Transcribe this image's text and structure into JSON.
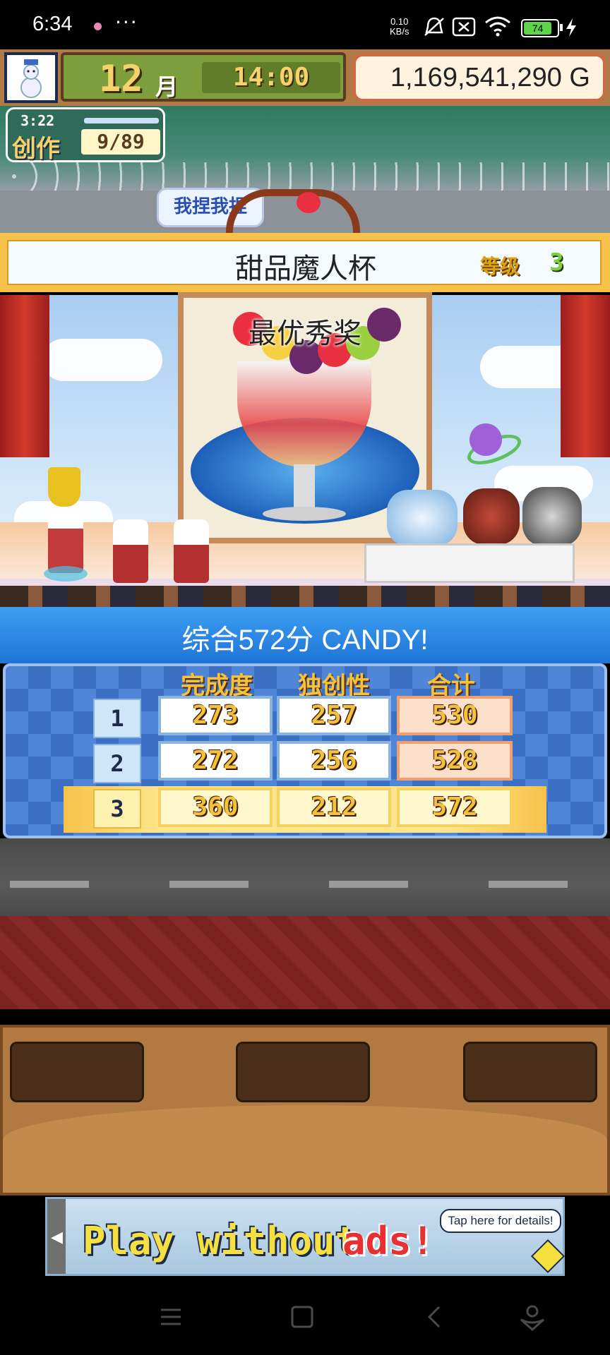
{
  "status_bar": {
    "time": "6:34",
    "more": "···",
    "net_speed_value": "0.10",
    "net_speed_unit": "KB/s",
    "battery": "74"
  },
  "hud": {
    "month_number": "12",
    "month_label": "月",
    "clock": "14:00",
    "gold": "1,169,541,290 G"
  },
  "create": {
    "timer": "3:22",
    "label": "创作",
    "count": "9/89"
  },
  "poke_button": "我捏我捏",
  "contest": {
    "name": "甜品魔人杯",
    "level_label": "等级",
    "level_value": "3"
  },
  "award": {
    "text": "最优秀奖"
  },
  "score_summary": "综合572分 CANDY!",
  "score_table": {
    "headers": [
      "完成度",
      "独创性",
      "合计"
    ],
    "rows": [
      {
        "rank": "1",
        "completion": "273",
        "originality": "257",
        "total": "530"
      },
      {
        "rank": "2",
        "completion": "272",
        "originality": "256",
        "total": "528"
      },
      {
        "rank": "3",
        "completion": "360",
        "originality": "212",
        "total": "572"
      }
    ]
  },
  "ad": {
    "text_main": "Play without",
    "text_accent": "ads!",
    "details": "Tap here for details!"
  },
  "colors": {
    "score_banner": "#1f74d6",
    "gold_panel_border": "#d06844",
    "title_banner": "#f6c24a"
  },
  "icons": {
    "avatar": "snowman-icon",
    "nav_menu": "menu-icon",
    "nav_home": "home-square-icon",
    "nav_back": "back-chevron-icon",
    "nav_assistant": "assistant-icon"
  }
}
